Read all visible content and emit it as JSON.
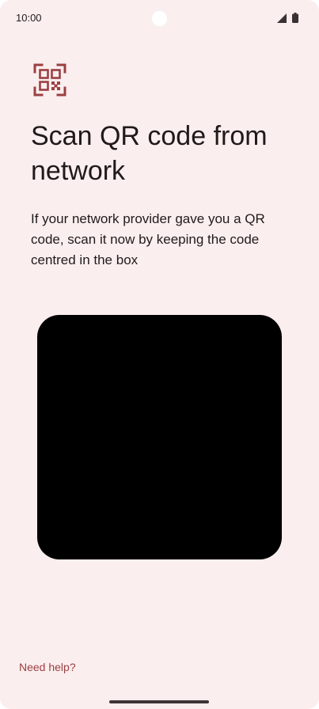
{
  "status_bar": {
    "time": "10:00",
    "icons": [
      "signal-icon",
      "battery-icon"
    ]
  },
  "page": {
    "icon": "qr-code-scanner-icon",
    "title": "Scan QR code from network",
    "description": "If your network provider gave you a QR code, scan it now by keeping the code centred in the box"
  },
  "footer": {
    "help_label": "Need help?"
  },
  "colors": {
    "background": "#fbeeee",
    "accent": "#9b4043",
    "text": "#201a1a",
    "viewfinder": "#000000"
  }
}
